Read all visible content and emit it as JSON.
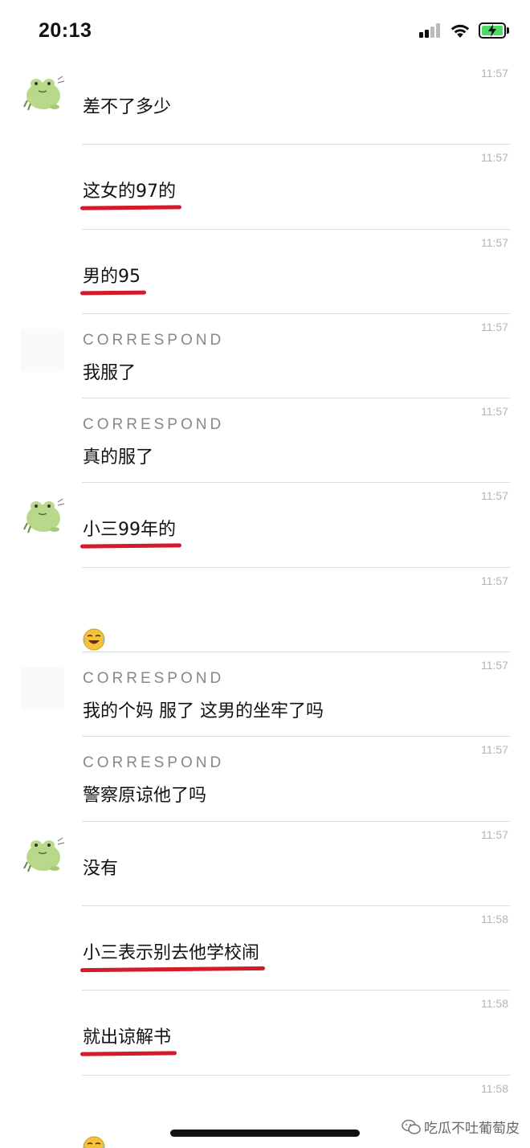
{
  "status_bar": {
    "time": "20:13"
  },
  "messages": [
    {
      "sender": "",
      "avatar": "frog",
      "text": "差不了多少",
      "time": "11:57"
    },
    {
      "sender": "",
      "avatar": "none",
      "text": "这女的97的",
      "time": "11:57",
      "underlined": true
    },
    {
      "sender": "",
      "avatar": "none",
      "text": "男的95",
      "time": "11:57",
      "underlined": true
    },
    {
      "sender": "CORRESPOND",
      "avatar": "blank",
      "text": "我服了",
      "time": "11:57"
    },
    {
      "sender": "CORRESPOND",
      "avatar": "none",
      "text": "真的服了",
      "time": "11:57"
    },
    {
      "sender": "",
      "avatar": "frog",
      "text": "小三99年的",
      "time": "11:57",
      "underlined": true
    },
    {
      "sender": "",
      "avatar": "none",
      "text": "",
      "emoji": "laugh-cry-emoji",
      "time": "11:57"
    },
    {
      "sender": "CORRESPOND",
      "avatar": "blank",
      "text": "我的个妈 服了 这男的坐牢了吗",
      "time": "11:57"
    },
    {
      "sender": "CORRESPOND",
      "avatar": "none",
      "text": "警察原谅他了吗",
      "time": "11:57"
    },
    {
      "sender": "",
      "avatar": "frog",
      "text": "没有",
      "time": "11:57"
    },
    {
      "sender": "",
      "avatar": "none",
      "text": "小三表示别去他学校闹",
      "time": "11:58",
      "underlined": true
    },
    {
      "sender": "",
      "avatar": "none",
      "text": "就出谅解书",
      "time": "11:58",
      "underlined": true
    },
    {
      "sender": "",
      "avatar": "none",
      "text": "",
      "emoji": "laugh-cry-emoji",
      "time": "11:58"
    }
  ],
  "watermark": {
    "text": "吃瓜不吐葡萄皮",
    "icon": "wechat-icon"
  },
  "colors": {
    "underline": "#d51b2a",
    "avatar_frog": "#b9d98a",
    "time_text": "#b4b4b4"
  }
}
